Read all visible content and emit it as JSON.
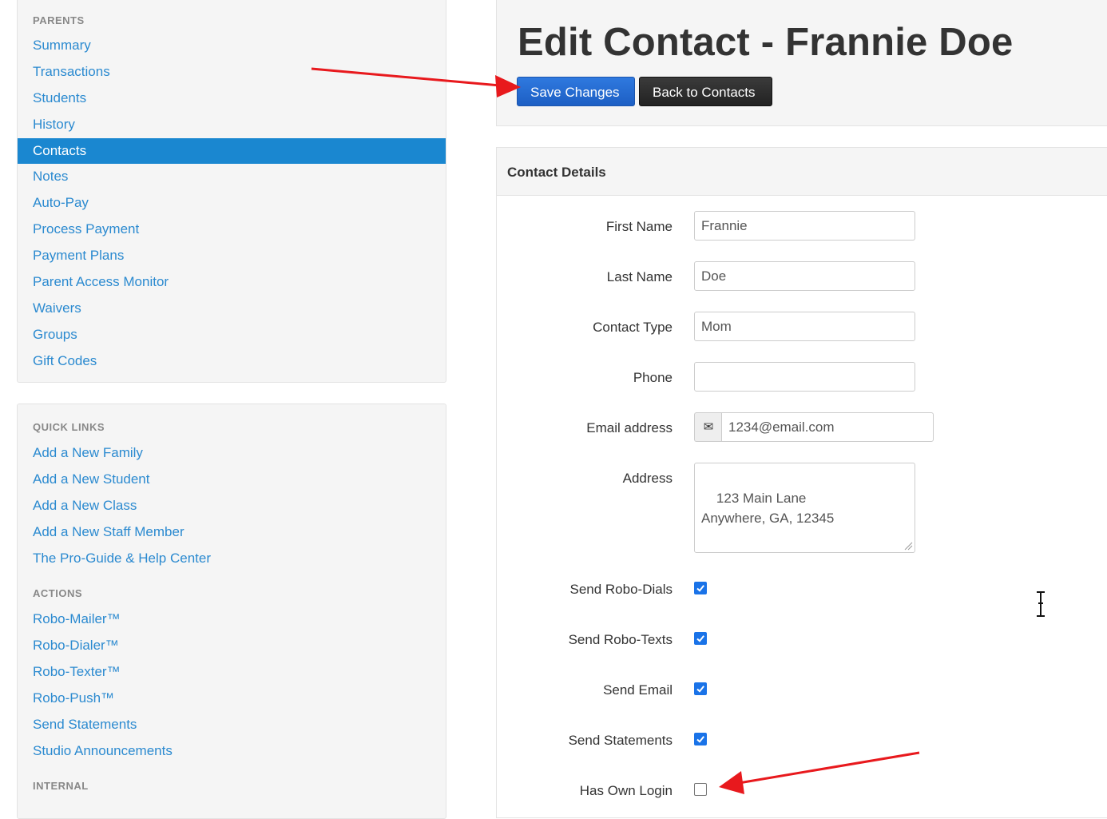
{
  "sidebar": {
    "parents": {
      "heading": "PARENTS",
      "items": [
        "Summary",
        "Transactions",
        "Students",
        "History",
        "Contacts",
        "Notes",
        "Auto-Pay",
        "Process Payment",
        "Payment Plans",
        "Parent Access Monitor",
        "Waivers",
        "Groups",
        "Gift Codes"
      ],
      "active": "Contacts"
    },
    "quick_links": {
      "heading": "QUICK LINKS",
      "items": [
        "Add a New Family",
        "Add a New Student",
        "Add a New Class",
        "Add a New Staff Member",
        "The Pro-Guide & Help Center"
      ]
    },
    "actions": {
      "heading": "ACTIONS",
      "items": [
        "Robo-Mailer™",
        "Robo-Dialer™",
        "Robo-Texter™",
        "Robo-Push™",
        "Send Statements",
        "Studio Announcements"
      ]
    },
    "internal": {
      "heading": "INTERNAL"
    }
  },
  "header": {
    "title": "Edit Contact - Frannie Doe",
    "save_label": "Save Changes",
    "back_label": "Back to Contacts"
  },
  "details": {
    "title": "Contact Details",
    "first_name_label": "First Name",
    "first_name": "Frannie",
    "last_name_label": "Last Name",
    "last_name": "Doe",
    "contact_type_label": "Contact Type",
    "contact_type": "Mom",
    "phone_label": "Phone",
    "phone": "",
    "email_label": "Email address",
    "email": "1234@email.com",
    "address_label": "Address",
    "address": "123 Main Lane\nAnywhere, GA, 12345",
    "robo_dials_label": "Send Robo-Dials",
    "robo_dials": true,
    "robo_texts_label": "Send Robo-Texts",
    "robo_texts": true,
    "send_email_label": "Send Email",
    "send_email": true,
    "send_statements_label": "Send Statements",
    "send_statements": true,
    "own_login_label": "Has Own Login",
    "own_login": false
  },
  "icons": {
    "email_addon": "envelope-icon",
    "cursor": "text-cursor-icon"
  },
  "colors": {
    "link": "#2b8ad0",
    "active_nav": "#1a87d0",
    "save_button": "#2f79df",
    "back_button": "#2b2b2b",
    "checkbox_on": "#1a73e8",
    "annotation_arrow": "#e8191d"
  }
}
